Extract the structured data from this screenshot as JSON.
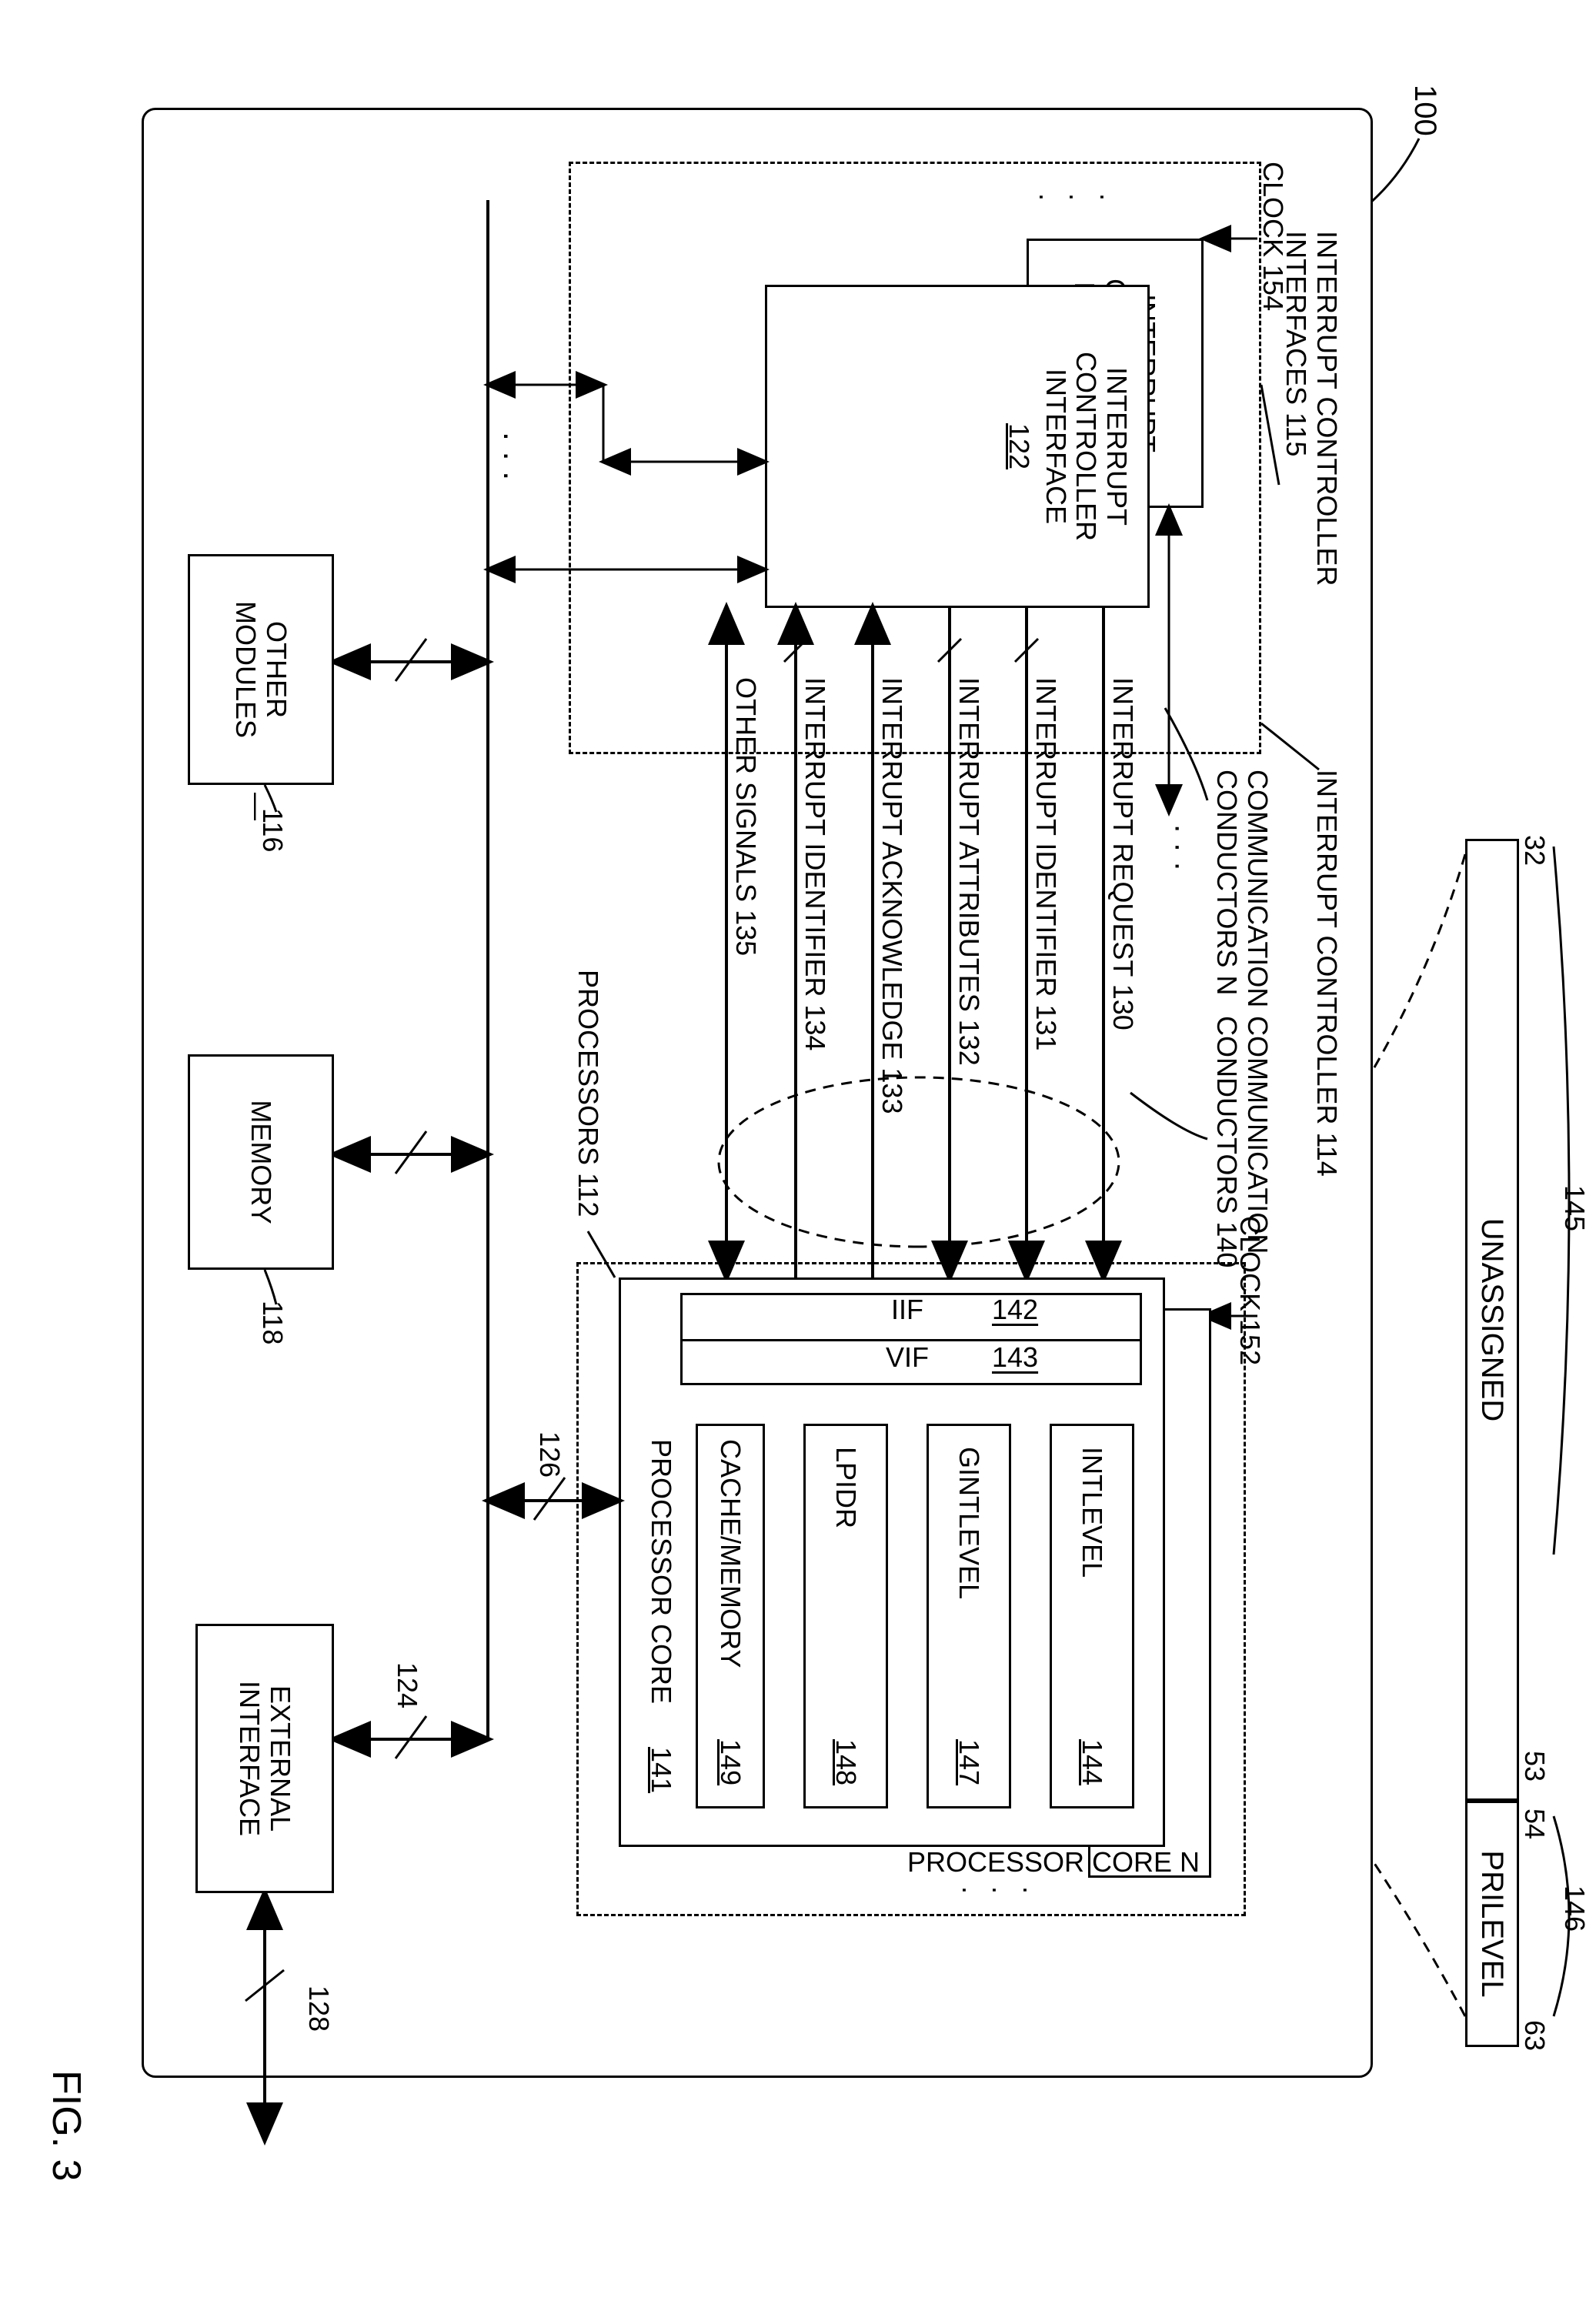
{
  "figure": {
    "ref": "100",
    "title": "FIG. 3"
  },
  "register": {
    "bits_start": "32",
    "unassigned_start": "53",
    "unassigned_end": "54",
    "bits_end": "63",
    "unassigned_label": "UNASSIGNED",
    "unassigned_ref": "145",
    "prilevel_label": "PRILEVEL",
    "prilevel_ref": "146"
  },
  "blocks": {
    "ic_interfaces": "INTERRUPT CONTROLLER\nINTERFACES 115",
    "interrupt_controller": "INTERRUPT CONTROLLER 114",
    "icin_top": "INTERRUPT\nCONTROLLER\nINTERFACE N",
    "icin_main": "INTERRUPT\nCONTROLLER\nINTERFACE",
    "icin_main_ref": "122",
    "clock_left": "CLOCK 154",
    "clock_right": "CLOCK 152",
    "comm_n": "COMMUNICATION\nCONDUCTORS N",
    "comm_140": "COMMUNICATION\nCONDUCTORS 140",
    "proc_core_n": "PROCESSOR CORE N",
    "proc_core_label": "PROCESSOR CORE",
    "proc_core_ref": "141",
    "iif": "IIF",
    "iif_ref": "142",
    "vif": "VIF",
    "vif_ref": "143",
    "intlevel": "INTLEVEL",
    "intlevel_ref": "144",
    "gintlevel": "GINTLEVEL",
    "gintlevel_ref": "147",
    "lpidr": "LPIDR",
    "lpidr_ref": "148",
    "cachemem": "CACHE/MEMORY",
    "cachemem_ref": "149",
    "processors": "PROCESSORS 112",
    "memory": "MEMORY",
    "memory_ref": "118",
    "other_modules": "OTHER\nMODULES",
    "other_modules_ref": "116",
    "external_if": "EXTERNAL\nINTERFACE",
    "external_if_ref_bus": "124",
    "external_if_ref_out": "128",
    "bus_126": "126"
  },
  "signals": {
    "s130": "INTERRUPT REQUEST 130",
    "s131": "INTERRUPT IDENTIFIER 131",
    "s132": "INTERRUPT ATTRIBUTES 132",
    "s133": "INTERRUPT ACKNOWLEDGE 133",
    "s134": "INTERRUPT IDENTIFIER 134",
    "s135": "OTHER SIGNALS 135"
  }
}
